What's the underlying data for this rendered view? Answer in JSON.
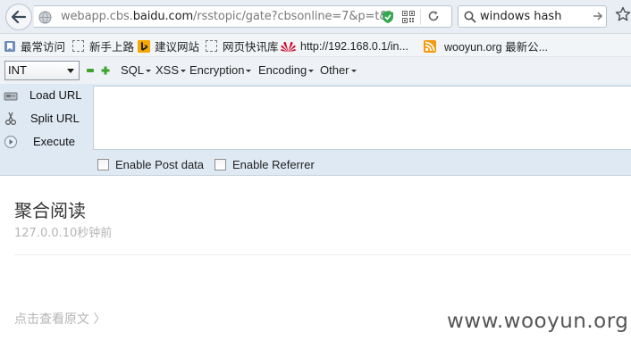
{
  "browser": {
    "url_host_prefix": "webapp.cbs.",
    "url_host_domain": "baidu.com",
    "url_path": "/rsstopic/gate?cbsonline=7&p=t&l",
    "search_value": "windows hash"
  },
  "bookmarks": [
    {
      "label": "最常访问",
      "icon": "bookmark-folder-icon"
    },
    {
      "label": "新手上路",
      "icon": "dashed-page-icon"
    },
    {
      "label": "建议网站",
      "icon": "bing-icon"
    },
    {
      "label": "网页快讯库",
      "icon": "dashed-page-icon"
    },
    {
      "label": "http://192.168.0.1/in...",
      "icon": "huawei-icon"
    },
    {
      "label": "wooyun.org 最新公...",
      "icon": "rss-icon"
    }
  ],
  "hackbar": {
    "select_value": "INT",
    "menus": [
      "SQL",
      "XSS",
      "Encryption",
      "Encoding",
      "Other"
    ],
    "load_url": "Load URL",
    "split_url": "Split URL",
    "execute": "Execute",
    "enable_post": "Enable Post data",
    "enable_referrer": "Enable Referrer",
    "url_text": ""
  },
  "content": {
    "title": "聚合阅读",
    "meta": "127.0.0.10秒钟前",
    "read_original": "点击查看原文 〉",
    "watermark": "www.wooyun.org"
  },
  "colors": {
    "chrome_bg": "#e9eef4",
    "hackbar_bg": "#dfe9f4",
    "bing_yellow": "#f5a800",
    "huawei_red": "#cf0a2c",
    "rss_orange": "#f39c12"
  }
}
